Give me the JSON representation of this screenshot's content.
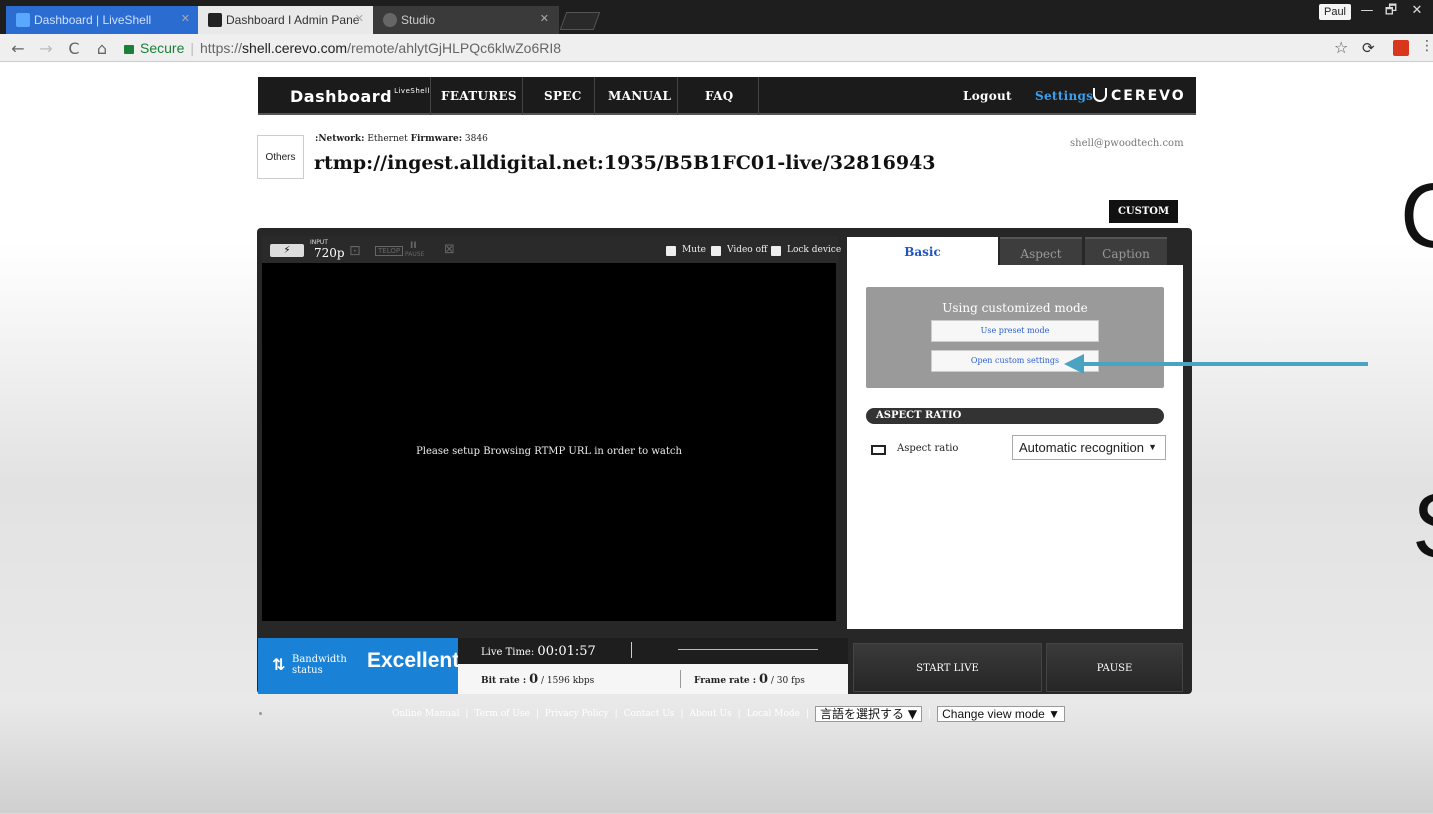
{
  "browser": {
    "tabs": [
      {
        "title": "Dashboard | LiveShell",
        "active": true
      },
      {
        "title": "Dashboard I Admin Pane",
        "active": false
      },
      {
        "title": "Studio",
        "active": false
      }
    ],
    "profile": "Paul",
    "window_buttons": [
      "—",
      "🗗",
      "✕"
    ],
    "address": {
      "secure_label": "Secure",
      "url_scheme": "https://",
      "url_host": "shell.cerevo.com",
      "url_path": "/remote/ahlytGjHLPQc6klwZo6RI8"
    }
  },
  "nav": {
    "logo": "Dashboard",
    "logo_sup": "LiveShell",
    "items": [
      "FEATURES",
      "SPEC",
      "MANUAL",
      "FAQ"
    ],
    "logout": "Logout",
    "settings": "Settings",
    "brand": "CEREVO"
  },
  "info": {
    "others_button": "Others",
    "network_label": ":Network:",
    "network_value": "Ethernet",
    "firmware_label": "Firmware:",
    "firmware_value": "3846",
    "rtmp_url": "rtmp://ingest.alldigital.net:1935/B5B1FC01-live/32816943",
    "email": "shell@pwoodtech.com",
    "custom_button": "CUSTOM"
  },
  "video": {
    "input_label": "INPUT",
    "resolution": "720p",
    "telop_label": "TELOP",
    "pause_label": "PAUSE",
    "options": [
      "Mute",
      "Video off",
      "Lock device"
    ],
    "message": "Please setup Browsing RTMP URL in order to watch"
  },
  "settings_panel": {
    "tabs": [
      "Basic",
      "Aspect",
      "Caption"
    ],
    "mode_title": "Using customized mode",
    "preset_button": "Use preset mode",
    "custom_button": "Open custom settings",
    "section_title": "ASPECT RATIO",
    "aspect_label": "Aspect ratio",
    "aspect_value": "Automatic recognition"
  },
  "status": {
    "bandwidth_label_1": "Bandwidth",
    "bandwidth_label_2": "status",
    "bandwidth_value": "Excellent",
    "live_time_label": "Live Time:",
    "live_time_value": "00:01:57",
    "bitrate_label": "Bit rate :",
    "bitrate_value": "0",
    "bitrate_max": "/ 1596 kbps",
    "framerate_label": "Frame rate :",
    "framerate_value": "0",
    "framerate_max": "/ 30 fps",
    "start_button": "START LIVE",
    "pause_button": "PAUSE"
  },
  "footer": {
    "links": [
      "Online Manual",
      "Term of Use",
      "Privacy Policy",
      "Contact Us",
      "About Us",
      "Local Mode"
    ],
    "language_select": "言語を選択する ▼",
    "view_mode_select": "Change view mode ▼"
  },
  "slide_glyphs": [
    "C",
    "S"
  ],
  "colors": {
    "accent_blue": "#1a82d6",
    "arrow": "#4aa3c0",
    "settings_link": "#39a0f0"
  }
}
